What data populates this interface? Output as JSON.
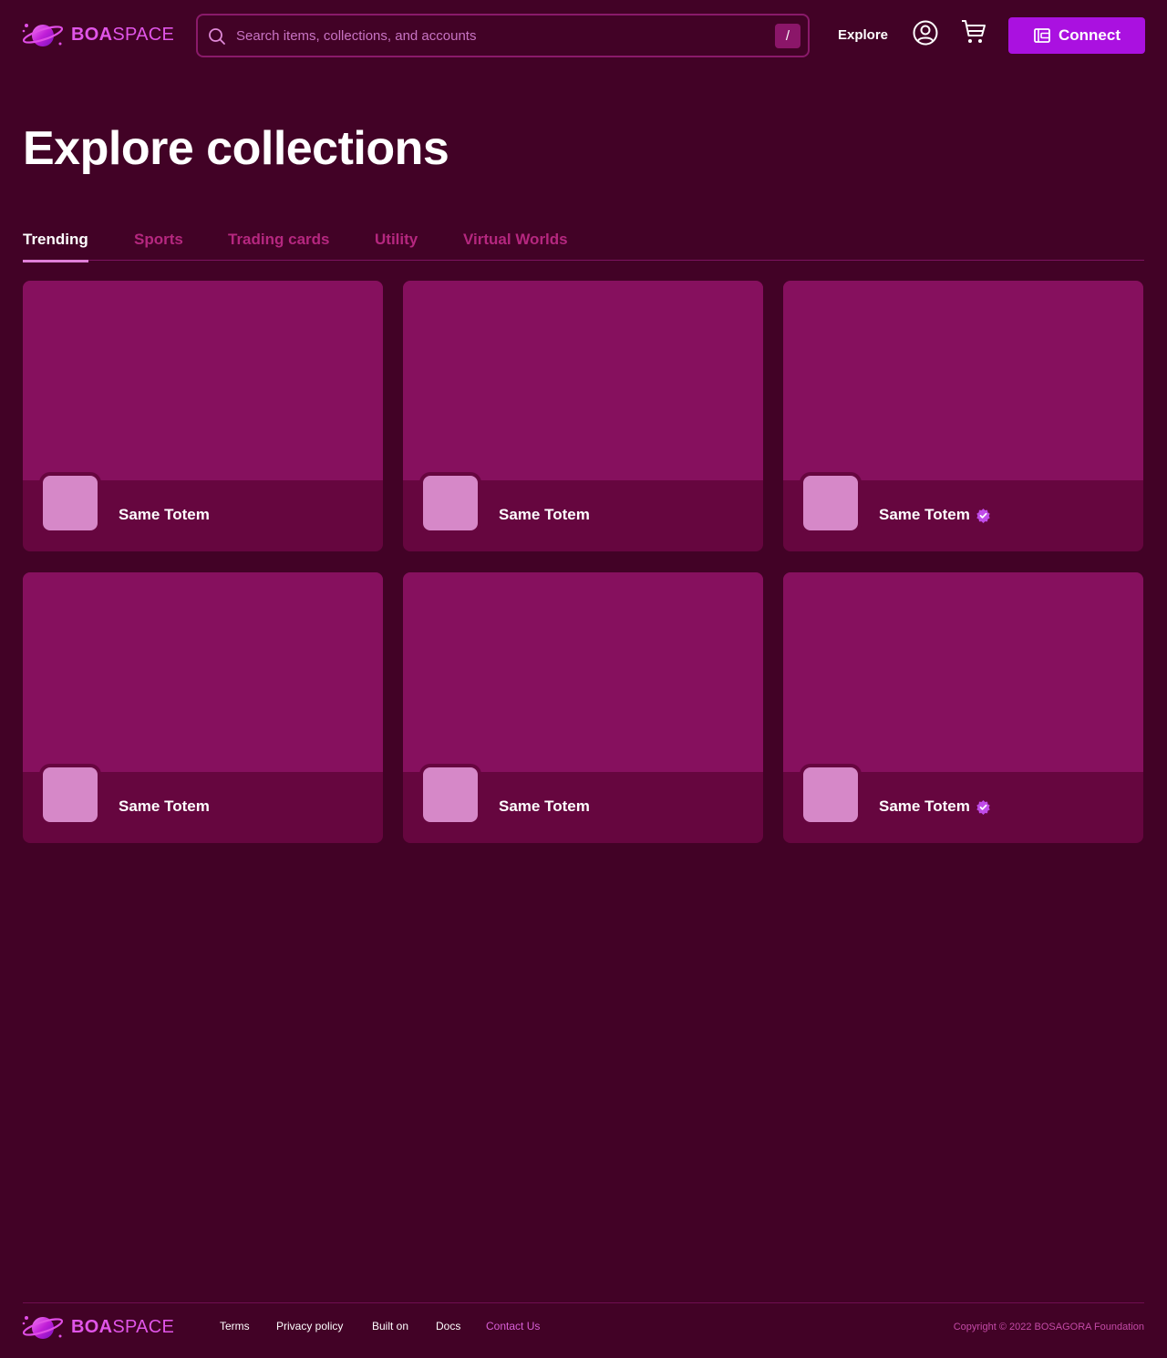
{
  "brand": {
    "bold": "BOA",
    "light": "SPACE"
  },
  "search": {
    "placeholder": "Search items, collections, and accounts",
    "shortcut": "/"
  },
  "nav": {
    "explore": "Explore",
    "connect": "Connect"
  },
  "page": {
    "title": "Explore collections"
  },
  "tabs": [
    {
      "label": "Trending",
      "active": true
    },
    {
      "label": "Sports",
      "active": false
    },
    {
      "label": "Trading cards",
      "active": false
    },
    {
      "label": "Utility",
      "active": false
    },
    {
      "label": "Virtual Worlds",
      "active": false
    }
  ],
  "collections": [
    {
      "name": "Same Totem",
      "verified": false
    },
    {
      "name": "Same Totem",
      "verified": false
    },
    {
      "name": "Same Totem",
      "verified": true
    },
    {
      "name": "Same Totem",
      "verified": false
    },
    {
      "name": "Same Totem",
      "verified": false
    },
    {
      "name": "Same Totem",
      "verified": true
    }
  ],
  "footer": {
    "links": [
      "Terms",
      "Privacy policy",
      "Built on",
      "Docs",
      "Contact Us"
    ],
    "copyright": "Copyright © 2022 BOSAGORA Foundation"
  },
  "colors": {
    "background": "#420226",
    "card_banner": "#86105e",
    "card_body": "#66063f",
    "accent": "#aa11e0",
    "brand_pink": "#e055e8"
  }
}
